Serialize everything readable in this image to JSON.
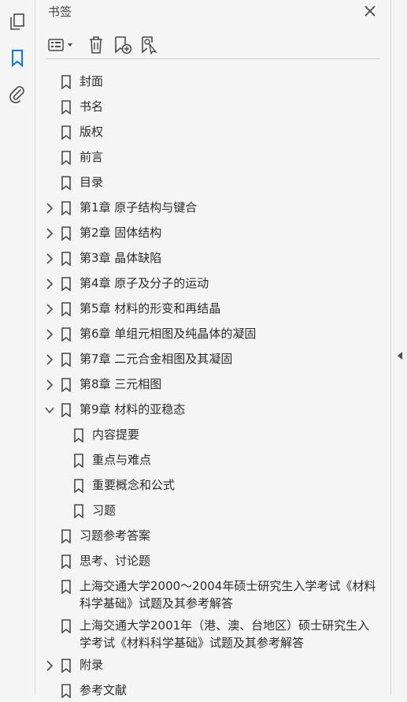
{
  "side_rail": {
    "items": [
      {
        "icon": "pages-icon"
      },
      {
        "icon": "bookmark-icon",
        "active": true
      },
      {
        "icon": "attachment-icon"
      }
    ]
  },
  "panel": {
    "title": "书签",
    "close_icon": "close-icon",
    "toolbar": [
      {
        "icon": "options-menu-icon"
      },
      {
        "icon": "delete-icon"
      },
      {
        "icon": "new-bookmark-icon"
      },
      {
        "icon": "find-bookmark-icon"
      }
    ]
  },
  "bookmarks": [
    {
      "label": "封面",
      "level": 0,
      "expander": "none"
    },
    {
      "label": "书名",
      "level": 0,
      "expander": "none"
    },
    {
      "label": "版权",
      "level": 0,
      "expander": "none"
    },
    {
      "label": "前言",
      "level": 0,
      "expander": "none"
    },
    {
      "label": "目录",
      "level": 0,
      "expander": "none"
    },
    {
      "label": "第1章  原子结构与键合",
      "level": 0,
      "expander": "collapsed"
    },
    {
      "label": "第2章  固体结构",
      "level": 0,
      "expander": "collapsed"
    },
    {
      "label": "第3章  晶体缺陷",
      "level": 0,
      "expander": "collapsed"
    },
    {
      "label": "第4章  原子及分子的运动",
      "level": 0,
      "expander": "collapsed"
    },
    {
      "label": "第5章  材料的形变和再结晶",
      "level": 0,
      "expander": "collapsed"
    },
    {
      "label": "第6章  单组元相图及纯晶体的凝固",
      "level": 0,
      "expander": "collapsed"
    },
    {
      "label": "第7章  二元合金相图及其凝固",
      "level": 0,
      "expander": "collapsed"
    },
    {
      "label": "第8章  三元相图",
      "level": 0,
      "expander": "collapsed"
    },
    {
      "label": "第9章  材料的亚稳态",
      "level": 0,
      "expander": "expanded"
    },
    {
      "label": "内容提要",
      "level": 1,
      "expander": "none"
    },
    {
      "label": "重点与难点",
      "level": 1,
      "expander": "none"
    },
    {
      "label": "重要概念和公式",
      "level": 1,
      "expander": "none"
    },
    {
      "label": "习题",
      "level": 1,
      "expander": "none"
    },
    {
      "label": "习题参考答案",
      "level": 0,
      "expander": "none"
    },
    {
      "label": "思考、讨论题",
      "level": 0,
      "expander": "none"
    },
    {
      "label": "上海交通大学2000～2004年硕士研究生入学考试《材料科学基础》试题及其参考解答",
      "level": 0,
      "expander": "none"
    },
    {
      "label": "上海交通大学2001年（港、澳、台地区）硕士研究生入学考试《材料科学基础》试题及其参考解答",
      "level": 0,
      "expander": "none"
    },
    {
      "label": "附录",
      "level": 0,
      "expander": "collapsed"
    },
    {
      "label": "参考文献",
      "level": 0,
      "expander": "none"
    }
  ],
  "colors": {
    "accent": "#1473e6",
    "icon": "#4b4b4b"
  }
}
